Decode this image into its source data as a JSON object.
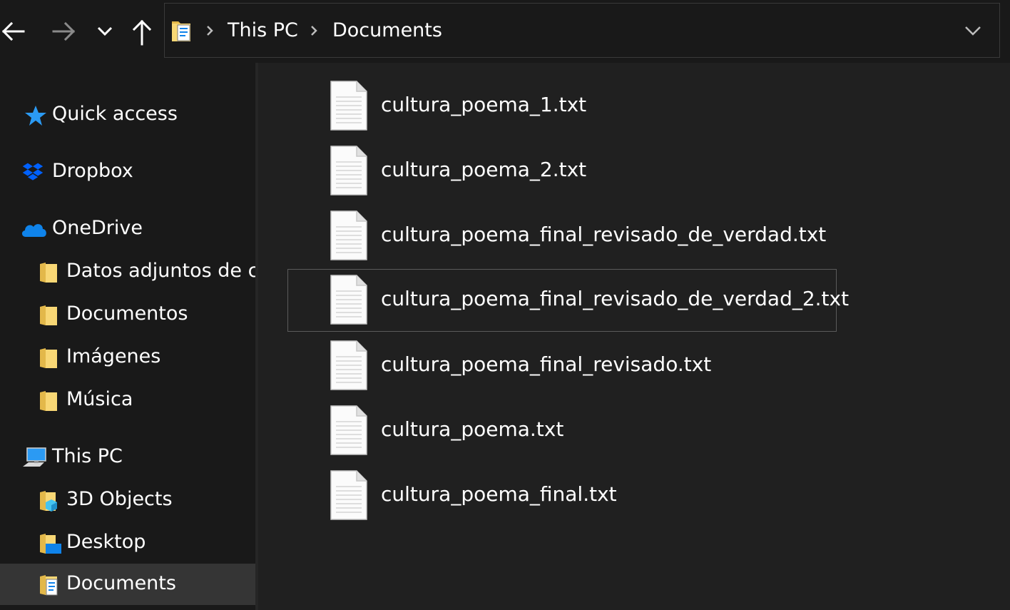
{
  "address_bar": {
    "crumbs": [
      "This PC",
      "Documents"
    ]
  },
  "sidebar": {
    "items": [
      {
        "label": "Quick access",
        "icon": "star-icon"
      },
      {
        "label": "Dropbox",
        "icon": "dropbox-icon"
      },
      {
        "label": "OneDrive",
        "icon": "cloud-icon"
      },
      {
        "label": "Datos adjuntos de c",
        "icon": "folder-icon"
      },
      {
        "label": "Documentos",
        "icon": "folder-icon"
      },
      {
        "label": "Imágenes",
        "icon": "folder-icon"
      },
      {
        "label": "Música",
        "icon": "folder-icon"
      },
      {
        "label": "This PC",
        "icon": "computer-icon"
      },
      {
        "label": "3D Objects",
        "icon": "3d-objects-folder-icon"
      },
      {
        "label": "Desktop",
        "icon": "desktop-folder-icon"
      },
      {
        "label": "Documents",
        "icon": "documents-folder-icon",
        "selected": true
      }
    ]
  },
  "files": [
    {
      "name": "cultura_poema_1.txt"
    },
    {
      "name": "cultura_poema_2.txt"
    },
    {
      "name": "cultura_poema_final_revisado_de_verdad.txt"
    },
    {
      "name": "cultura_poema_final_revisado_de_verdad_2.txt",
      "focused": true
    },
    {
      "name": "cultura_poema_final_revisado.txt"
    },
    {
      "name": "cultura_poema.txt"
    },
    {
      "name": "cultura_poema_final.txt"
    }
  ],
  "colors": {
    "background": "#191919",
    "content_background": "#202020",
    "selected_background": "#353535",
    "focus_border": "#5b5b5b",
    "text": "#ffffff",
    "folder_yellow": "#f8d775",
    "accent_blue": "#0f83ea"
  }
}
